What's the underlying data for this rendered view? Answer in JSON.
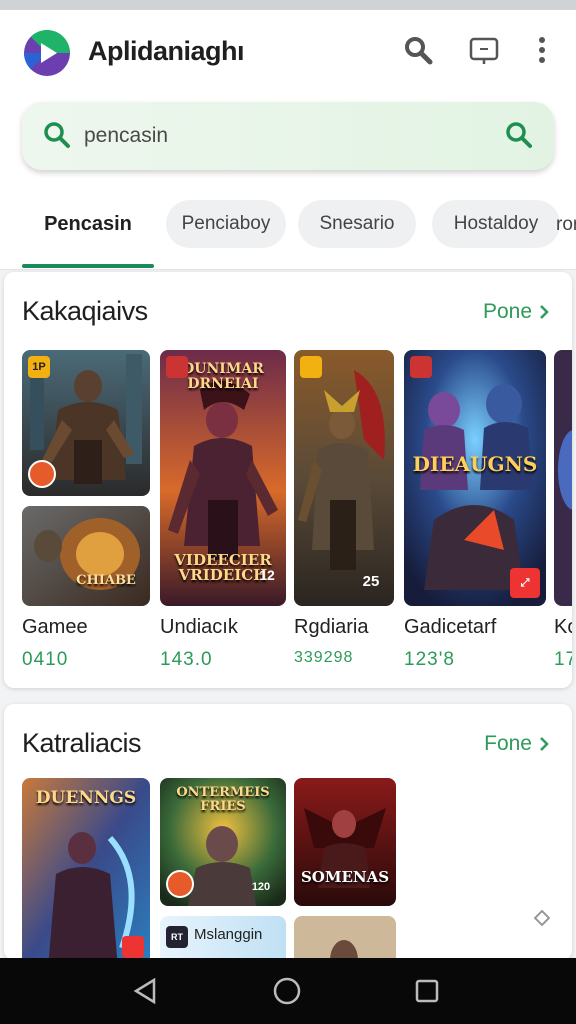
{
  "app": {
    "title": "Aplidaniaghı"
  },
  "search": {
    "value": "pencasin"
  },
  "tabs": {
    "active": "Pencasin",
    "chips": [
      "Penciaboy",
      "Snesario",
      "Hostaldoy",
      "ror"
    ]
  },
  "section1": {
    "title": "Kakaqiaivs",
    "link": "Pone",
    "tile_captions": {
      "t2_top": "DUNIMAR DRNEIAI",
      "t2_bottom": "VIDEECIER VRIDEICH",
      "t2_tag": "12",
      "t4_middle": "DIEAUGNS",
      "t5_tag": "25",
      "t1_tag": "1P",
      "t6_label": "CHIABE"
    },
    "items": [
      {
        "name": "Gamee",
        "rating": "0410"
      },
      {
        "name": "Undiacık",
        "rating": "143.0"
      },
      {
        "name": "Rgdiaria",
        "rating": "339298"
      },
      {
        "name": "Gadicetarf",
        "rating": "123'8"
      },
      {
        "name": "Ko",
        "rating": "17"
      }
    ]
  },
  "section2": {
    "title": "Katraliacis",
    "link": "Fone",
    "tile_captions": {
      "t1_top": "DUENNGS",
      "t2_top": "ONTERMEIS FRIES",
      "t2_tag": "120",
      "t3_bottom": "SOMENAS",
      "t4_label": "Mslanggin",
      "t4_badge": "RT"
    }
  },
  "colors": {
    "accent": "#2e9a5a",
    "tab_underline": "#1a8a5a",
    "search_bg": "#e8f5e9"
  }
}
